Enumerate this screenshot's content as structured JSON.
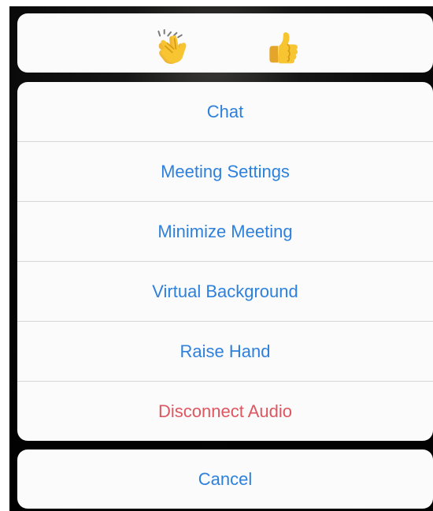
{
  "reactions": [
    {
      "icon": "clapping-hands-icon"
    },
    {
      "icon": "thumbs-up-icon"
    }
  ],
  "actions": {
    "chat": "Chat",
    "meeting_settings": "Meeting Settings",
    "minimize_meeting": "Minimize Meeting",
    "virtual_background": "Virtual Background",
    "raise_hand": "Raise Hand",
    "disconnect_audio": "Disconnect Audio"
  },
  "cancel": "Cancel",
  "colors": {
    "action_blue": "#2d80dc",
    "destructive_red": "#dd5660",
    "sheet_background": "#fbfbfb",
    "separator": "#d6d6d6",
    "emoji_yellow": "#f7c531"
  }
}
